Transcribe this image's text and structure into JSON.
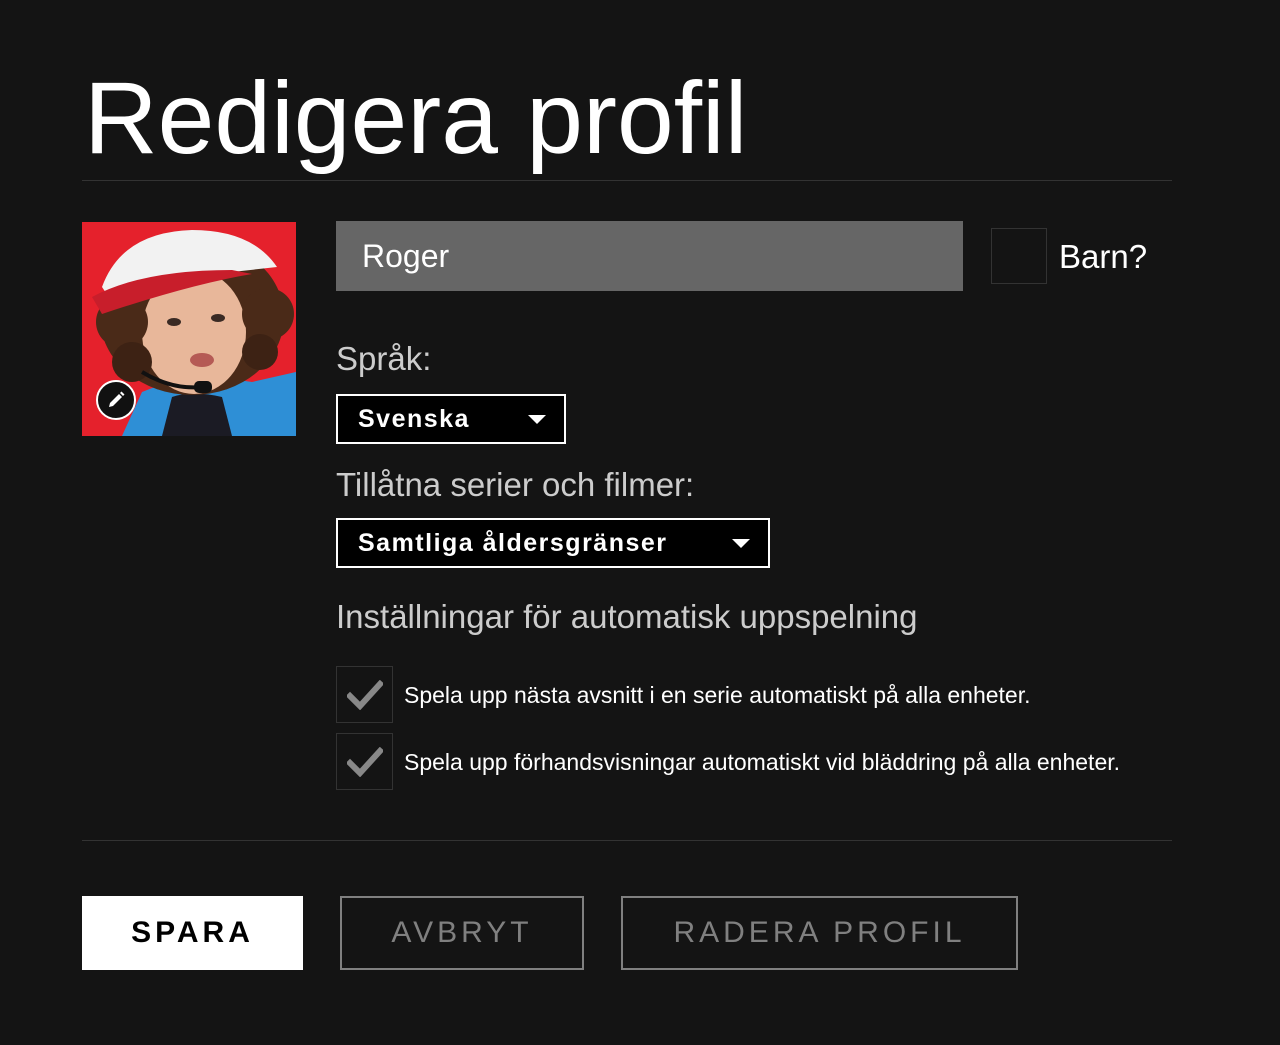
{
  "page": {
    "title": "Redigera profil"
  },
  "profile": {
    "avatar_icon": "profile-avatar",
    "edit_icon": "pencil-icon",
    "name_value": "Roger",
    "kid_label": "Barn?",
    "kid_checked": false
  },
  "language": {
    "label": "Språk:",
    "selected": "Svenska"
  },
  "maturity": {
    "label": "Tillåtna serier och filmer:",
    "selected": "Samtliga åldersgränser"
  },
  "autoplay": {
    "heading": "Inställningar för automatisk uppspelning",
    "options": [
      {
        "label": "Spela upp nästa avsnitt i en serie automatiskt på alla enheter.",
        "checked": true
      },
      {
        "label": "Spela upp förhandsvisningar automatiskt vid bläddring på alla enheter.",
        "checked": true
      }
    ]
  },
  "buttons": {
    "save": "SPARA",
    "cancel": "AVBRYT",
    "delete": "RADERA PROFIL"
  },
  "colors": {
    "background": "#141414",
    "input_bg": "#666666",
    "muted": "#808080",
    "avatar_bg": "#e5212c"
  }
}
